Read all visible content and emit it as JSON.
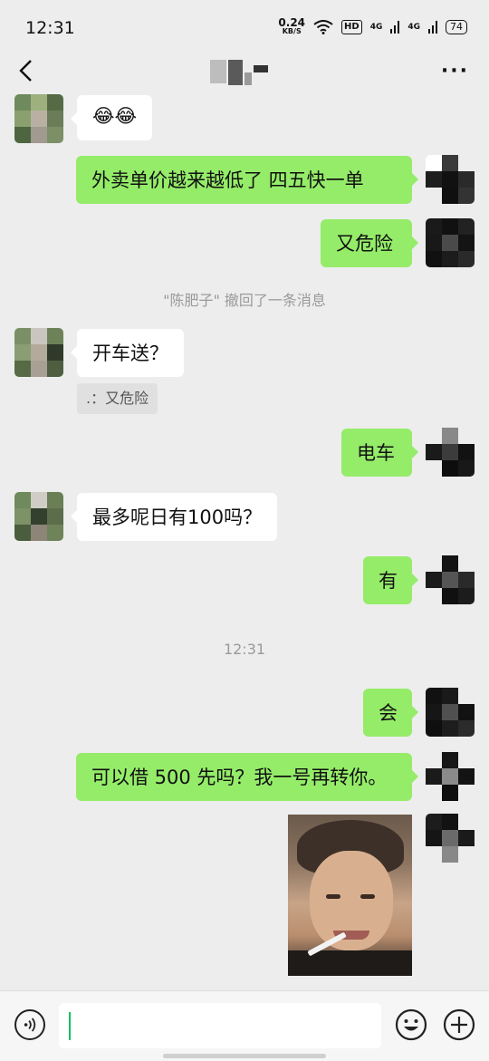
{
  "status_bar": {
    "time": "12:31",
    "net_speed_value": "0.24",
    "net_speed_unit": "KB/S",
    "hd_label": "HD",
    "signal1_label": "4G",
    "signal2_label": "4G",
    "battery": "74"
  },
  "header": {
    "back_icon": "back-arrow-icon",
    "more_icon": "more-dots-icon",
    "more_glyph": "···"
  },
  "messages": [
    {
      "side": "in",
      "text": "😂😂"
    },
    {
      "side": "out",
      "text": "外卖单价越来越低了 四五快一单"
    },
    {
      "side": "out",
      "text": "又危险"
    },
    {
      "side": "in",
      "text": "开车送？"
    },
    {
      "side": "out",
      "text": "电车"
    },
    {
      "side": "in",
      "text": "最多呢日有100吗？"
    },
    {
      "side": "out",
      "text": "有"
    },
    {
      "side": "out",
      "text": "会"
    },
    {
      "side": "out",
      "text": "可以借 500 先吗？我一号再转你。"
    }
  ],
  "recall_notice": "\"陈肥子\" 撤回了一条消息",
  "quote_text": ".：又危险",
  "timestamp": "12:31",
  "input_bar": {
    "voice_icon": "voice-icon",
    "emoji_icon": "emoji-icon",
    "plus_icon": "plus-icon"
  },
  "colors": {
    "background": "#ededed",
    "out_bubble": "#95ec69",
    "in_bubble": "#ffffff",
    "caret": "#07c160"
  }
}
